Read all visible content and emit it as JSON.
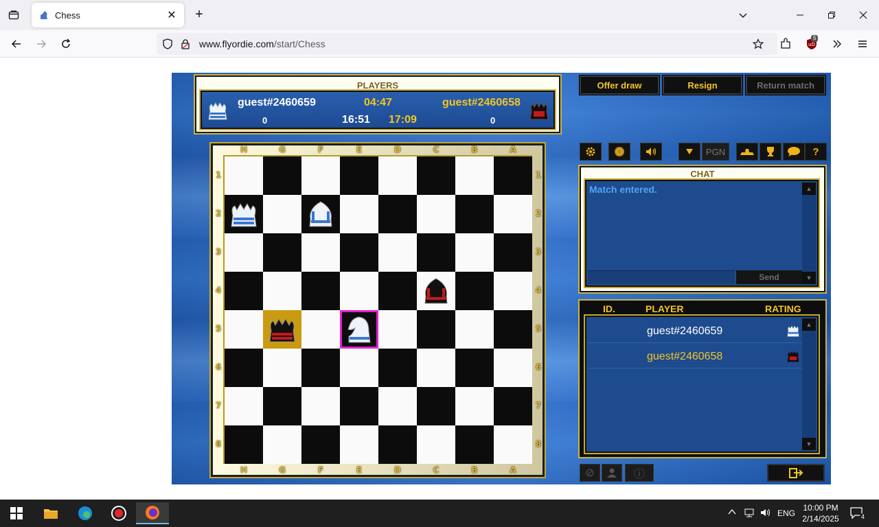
{
  "browser": {
    "tab_title": "Chess",
    "new_tab_symbol": "+",
    "close_symbol": "✕",
    "url_host": "www.flyordie.com",
    "url_path": "/start/Chess",
    "extension_badge": "5"
  },
  "players": {
    "title": "PLAYERS",
    "white_name": "guest#2460659",
    "black_name": "guest#2460658",
    "move_timer": "04:47",
    "white_clock": "16:51",
    "black_clock": "17:09",
    "white_score": "0",
    "black_score": "0",
    "white_color": "#ffffff",
    "black_color": "#f3c623"
  },
  "board": {
    "files": [
      "H",
      "G",
      "F",
      "E",
      "D",
      "C",
      "B",
      "A"
    ],
    "ranks": [
      "1",
      "2",
      "3",
      "4",
      "5",
      "6",
      "7",
      "8"
    ],
    "pieces": [
      {
        "square": "H2",
        "side": "white",
        "kind": "king"
      },
      {
        "square": "F2",
        "side": "white",
        "kind": "bishop"
      },
      {
        "square": "C4",
        "side": "black",
        "kind": "bishop"
      },
      {
        "square": "G5",
        "side": "black",
        "kind": "king"
      },
      {
        "square": "E5",
        "side": "white",
        "kind": "knight"
      }
    ],
    "highlight_gold": "G5",
    "highlight_pink": "E5"
  },
  "actions": {
    "offer_draw": "Offer draw",
    "resign": "Resign",
    "return_match": "Return match"
  },
  "toolbar": {
    "pgn": "PGN",
    "help": "?"
  },
  "chat": {
    "title": "CHAT",
    "message": "Match entered.",
    "send": "Send"
  },
  "list": {
    "col_id": "ID.",
    "col_player": "PLAYER",
    "col_rating": "RATING",
    "rows": [
      {
        "name": "guest#2460659",
        "color": "#ffffff"
      },
      {
        "name": "guest#2460658",
        "color": "#f3c623"
      }
    ]
  },
  "taskbar": {
    "lang": "ENG",
    "time": "10:00 PM",
    "date": "2/14/2025",
    "notif_count": "4"
  }
}
